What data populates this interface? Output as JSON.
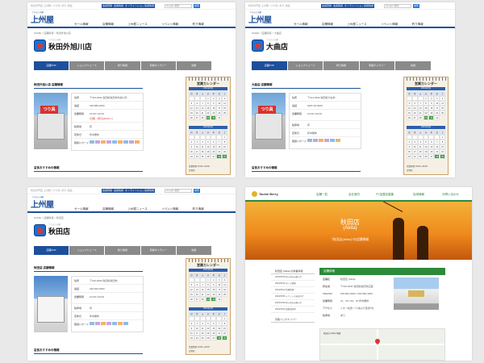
{
  "header": {
    "logo_text": "上州屋",
    "logo_sub": "つりの上州屋",
    "tagline": "釣具専門店 上州屋 | つり具 | 釣り 用品",
    "btn_login": "会員登録",
    "btn_member": "会員情報",
    "btn_shop": "オンラインショップ",
    "btn_recruit": "採用情報",
    "search_placeholder": "Google 検索",
    "search_button": "検索",
    "nav": [
      "セール情報",
      "店舗情報",
      "上州屋ニュース",
      "イベント情報",
      "釣り情報"
    ]
  },
  "tabs": [
    "店舗TOP",
    "ショップニュース",
    "釣り情報",
    "有線ギャラリー",
    "採用"
  ],
  "calendar": {
    "title": "営業カレンダー",
    "month1": "2024年5月",
    "month2": "2024年6月",
    "weekdays": [
      "日",
      "月",
      "火",
      "水",
      "木",
      "金",
      "土"
    ],
    "legend": "営業時間 10:00～20:00",
    "legend2": "定休日"
  },
  "store_info_rows": {
    "address_label": "住所",
    "phone_label": "電話",
    "hours_label": "営業時間",
    "parking_label": "駐車場",
    "closed_label": "定休日",
    "payment_label": "取扱いカード"
  },
  "panels": {
    "p1": {
      "crumb": "HOME > 店舗情報 > 秋田外旭川店",
      "store_name": "秋田外旭川店",
      "store_small": "つりの上州屋",
      "section_info": "秋田外旭川店 店舗情報",
      "section_reco": "店長おすすめの情報",
      "sign": "つり具",
      "address": "〒010-0061 秋田県秋田市外旭川字...",
      "phone": "018-880-0000",
      "hours": "10:00～20:00",
      "hours_note": "(日曜・祝日は9:00～)",
      "parking": "有",
      "closed": "年中無休"
    },
    "p2": {
      "crumb": "HOME > 店舗情報 > 大曲店",
      "store_name": "大曲店",
      "store_small": "つりの上州屋",
      "section_info": "大曲店 店舗情報",
      "section_reco": "店長おすすめの情報",
      "sign": "つり具",
      "address": "〒014-0000 秋田県大仙市...",
      "phone": "0187-00-0000",
      "hours": "10:00～20:00",
      "parking": "有",
      "closed": "年中無休"
    },
    "p3": {
      "crumb": "HOME > 店舗情報 > 秋田店",
      "store_name": "秋田店",
      "store_small": "つりの上州屋",
      "section_info": "秋田店 店舗情報",
      "section_reco": "店長おすすめの情報",
      "address": "〒010-0000 秋田県秋田市...",
      "phone": "018-000-0000",
      "hours": "10:00～20:00",
      "parking": "有",
      "closed": "年中無休"
    },
    "p4": {
      "logo": "Tackle Berry",
      "nav": [
        "店舗一覧",
        "会社案内",
        "FC加盟店募集",
        "採用情報",
        "お問い合わせ"
      ],
      "hero_title": "秋田店",
      "hero_sub": "(Akita)",
      "hero_desc": "\"秋田店(Akita)\"の店舗情報",
      "sidebar_head": "秋田店 (Akita) の新着情報",
      "sidebar_items": [
        "2024/05/25 新入荷のお知らせ",
        "2024/05/18 セール情報",
        "2024/05/12 釣果情報",
        "2024/05/05 イベントのお知らせ",
        "2024/04/28 新入荷のお知らせ",
        "2024/04/20 買取強化中"
      ],
      "sidebar_more": "月別バックナンバー",
      "detail_head": "店舗詳細",
      "rows": [
        {
          "k": "店舗名",
          "v": "秋田店 (Akita)"
        },
        {
          "k": "所在地",
          "v": "〒010-0041 秋田県秋田市広面"
        },
        {
          "k": "TEL/FAX",
          "v": "018-893-3309 / 018-893-3309"
        },
        {
          "k": "営業時間",
          "v": "10：00～20：00 年中無休"
        },
        {
          "k": "アクセス",
          "v": "イオン秋田 バス停より徒歩5分"
        },
        {
          "k": "駐車場",
          "v": "あり"
        }
      ],
      "map_label": "秋田店 (Akita) 地図"
    }
  }
}
